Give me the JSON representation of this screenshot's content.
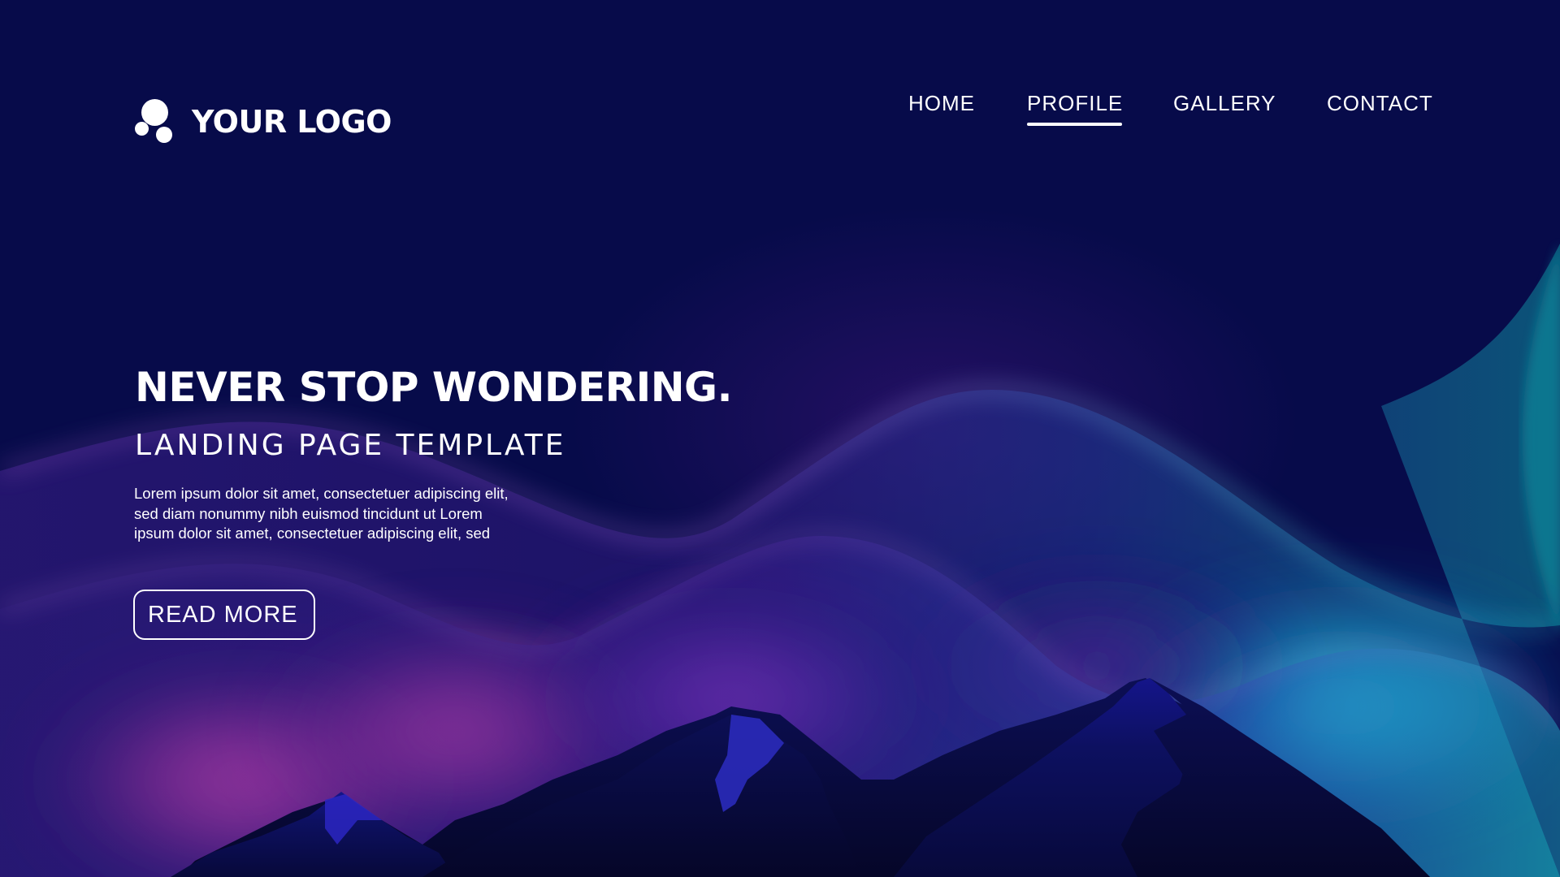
{
  "header": {
    "logo_text": "YOUR LOGO",
    "logo_icon": "three-dots-logo-icon"
  },
  "nav": {
    "items": [
      {
        "label": "HOME",
        "active": false
      },
      {
        "label": "PROFILE",
        "active": true
      },
      {
        "label": "GALLERY",
        "active": false
      },
      {
        "label": "CONTACT",
        "active": false
      }
    ]
  },
  "hero": {
    "title": "NEVER STOP WONDERING.",
    "subtitle": "LANDING PAGE TEMPLATE",
    "body_lines": [
      "Lorem ipsum dolor sit amet, consectetuer adipiscing elit,",
      "sed diam nonummy nibh euismod tincidunt ut Lorem",
      "ipsum dolor sit amet, consectetuer adipiscing elit, sed"
    ],
    "button_label": "READ MORE"
  },
  "colors": {
    "background": "#070b4a",
    "text": "#ffffff",
    "aurora_pink": "#ff4fb8",
    "aurora_purple": "#8a3bd0",
    "aurora_teal": "#16b3c9",
    "mountain": "#0a0d45"
  }
}
